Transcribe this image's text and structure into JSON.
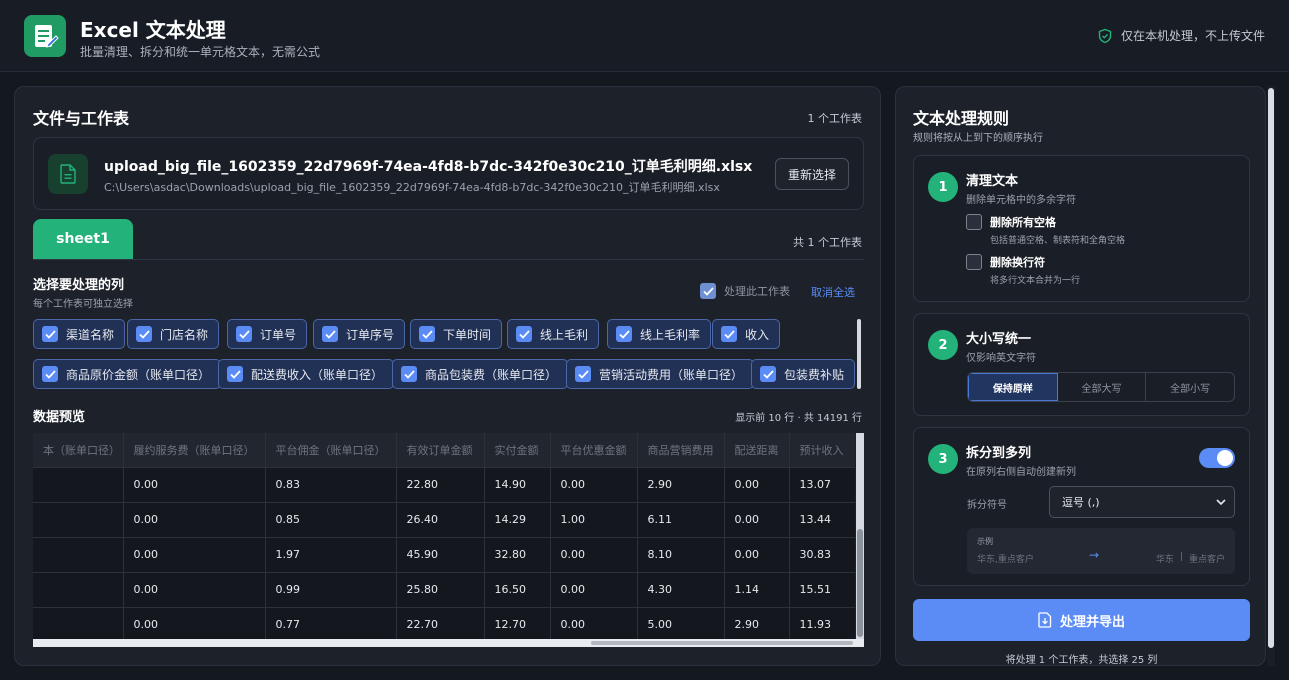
{
  "app": {
    "title": "Excel 文本处理",
    "subtitle": "批量清理、拆分和统一单元格文本，无需公式",
    "privacy": "仅在本机处理，不上传文件"
  },
  "files": {
    "title": "文件与工作表",
    "sheet_count": "1 个工作表",
    "file_name": "upload_big_file_1602359_22d7969f-74ea-4fd8-b7dc-342f0e30c210_订单毛利明细.xlsx",
    "file_path": "C:\\Users\\asdac\\Downloads\\upload_big_file_1602359_22d7969f-74ea-4fd8-b7dc-342f0e30c210_订单毛利明细.xlsx",
    "reselect": "重新选择",
    "tab": "sheet1",
    "tab_total": "共 1 个工作表"
  },
  "columns": {
    "title": "选择要处理的列",
    "hint": "每个工作表可独立选择",
    "process_sheet": "处理此工作表",
    "deselect_all": "取消全选",
    "items": [
      "渠道名称",
      "门店名称",
      "订单号",
      "订单序号",
      "下单时间",
      "线上毛利",
      "线上毛利率",
      "收入",
      "商品原价金额（账单口径）",
      "配送费收入（账单口径）",
      "商品包装费（账单口径）",
      "营销活动费用（账单口径）",
      "包装费补贴"
    ]
  },
  "preview": {
    "title": "数据预览",
    "info": "显示前 10 行 · 共 14191 行",
    "headers": [
      "本（账单口径）",
      "履约服务费（账单口径）",
      "平台佣金（账单口径）",
      "有效订单金额",
      "实付金额",
      "平台优惠金额",
      "商品营销费用",
      "配送距离",
      "预计收入"
    ],
    "rows": [
      [
        "",
        "0.00",
        "0.83",
        "22.80",
        "14.90",
        "0.00",
        "2.90",
        "0.00",
        "13.07"
      ],
      [
        "",
        "0.00",
        "0.85",
        "26.40",
        "14.29",
        "1.00",
        "6.11",
        "0.00",
        "13.44"
      ],
      [
        "",
        "0.00",
        "1.97",
        "45.90",
        "32.80",
        "0.00",
        "8.10",
        "0.00",
        "30.83"
      ],
      [
        "",
        "0.00",
        "0.99",
        "25.80",
        "16.50",
        "0.00",
        "4.30",
        "1.14",
        "15.51"
      ],
      [
        "",
        "0.00",
        "0.77",
        "22.70",
        "12.70",
        "0.00",
        "5.00",
        "2.90",
        "11.93"
      ]
    ]
  },
  "rules": {
    "title": "文本处理规则",
    "subtitle": "规则将按从上到下的顺序执行",
    "clean": {
      "step": "1",
      "title": "清理文本",
      "subtitle": "删除单元格中的多余字符",
      "opt1_label": "删除所有空格",
      "opt1_desc": "包括普通空格、制表符和全角空格",
      "opt2_label": "删除换行符",
      "opt2_desc": "将多行文本合并为一行"
    },
    "case": {
      "step": "2",
      "title": "大小写统一",
      "subtitle": "仅影响英文字符",
      "options": [
        "保持原样",
        "全部大写",
        "全部小写"
      ]
    },
    "split": {
      "step": "3",
      "title": "拆分到多列",
      "subtitle": "在原列右侧自动创建新列",
      "sep_label": "拆分符号",
      "sep_value": "逗号 (,)",
      "example_label": "示例",
      "example_in": "华东,重点客户",
      "example_arrow": "→",
      "example_out1": "华东",
      "example_sep": "|",
      "example_out2": "重点客户"
    },
    "export": "处理并导出",
    "footer": "将处理 1 个工作表，共选择 25 列"
  },
  "colors": {
    "accent_green": "#23b27a",
    "accent_blue": "#5b8cf5"
  }
}
